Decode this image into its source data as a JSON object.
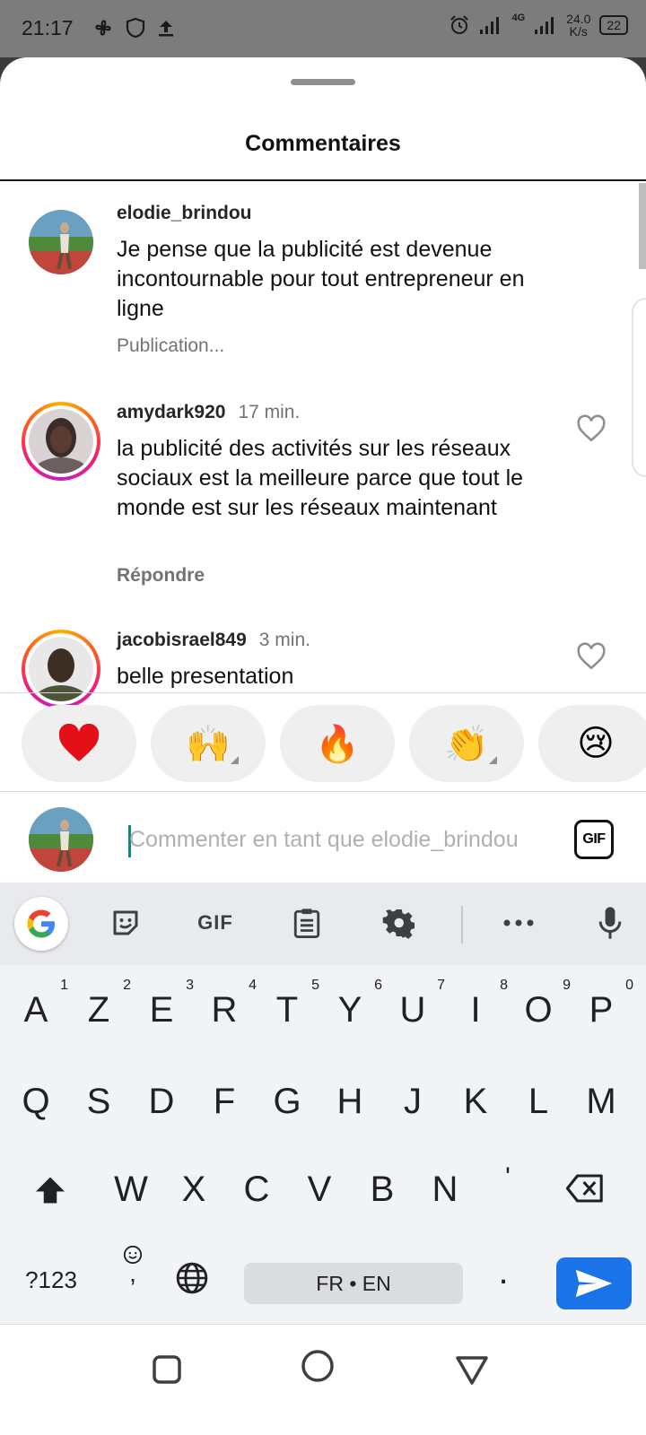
{
  "status_bar": {
    "time": "21:17",
    "network": "4G",
    "speed_value": "24.0",
    "speed_unit": "K/s",
    "battery": "22"
  },
  "sheet": {
    "title": "Commentaires"
  },
  "comments": [
    {
      "username": "elodie_brindou",
      "time": "",
      "text": "Je pense que la publicité est devenue incontournable pour tout entrepreneur en ligne",
      "meta": "Publication..."
    },
    {
      "username": "amydark920",
      "time": "17 min.",
      "text": "la publicité des activités sur les réseaux sociaux est la meilleure parce que tout le monde est sur les réseaux maintenant",
      "meta": "Répondre"
    },
    {
      "username": "jacobisrael849",
      "time": "3 min.",
      "text": "belle presentation",
      "meta": ""
    }
  ],
  "reactions": [
    "❤️",
    "🙌",
    "🔥",
    "👏",
    "😢"
  ],
  "comment_input": {
    "placeholder": "Commenter en tant que elodie_brindou",
    "gif_label": "GIF"
  },
  "keyboard": {
    "toolbar_gif": "GIF",
    "row1": [
      {
        "k": "A",
        "n": "1"
      },
      {
        "k": "Z",
        "n": "2"
      },
      {
        "k": "E",
        "n": "3"
      },
      {
        "k": "R",
        "n": "4"
      },
      {
        "k": "T",
        "n": "5"
      },
      {
        "k": "Y",
        "n": "6"
      },
      {
        "k": "U",
        "n": "7"
      },
      {
        "k": "I",
        "n": "8"
      },
      {
        "k": "O",
        "n": "9"
      },
      {
        "k": "P",
        "n": "0"
      }
    ],
    "row2": [
      "Q",
      "S",
      "D",
      "F",
      "G",
      "H",
      "J",
      "K",
      "L",
      "M"
    ],
    "row3": [
      "W",
      "X",
      "C",
      "V",
      "B",
      "N",
      "'"
    ],
    "symbols_key": "?123",
    "comma_key": ",",
    "period_key": ".",
    "language": "FR • EN"
  },
  "colors": {
    "accent": "#1a73e8",
    "heart": "#ed1c24",
    "status_bar": "#7c7c7c"
  }
}
